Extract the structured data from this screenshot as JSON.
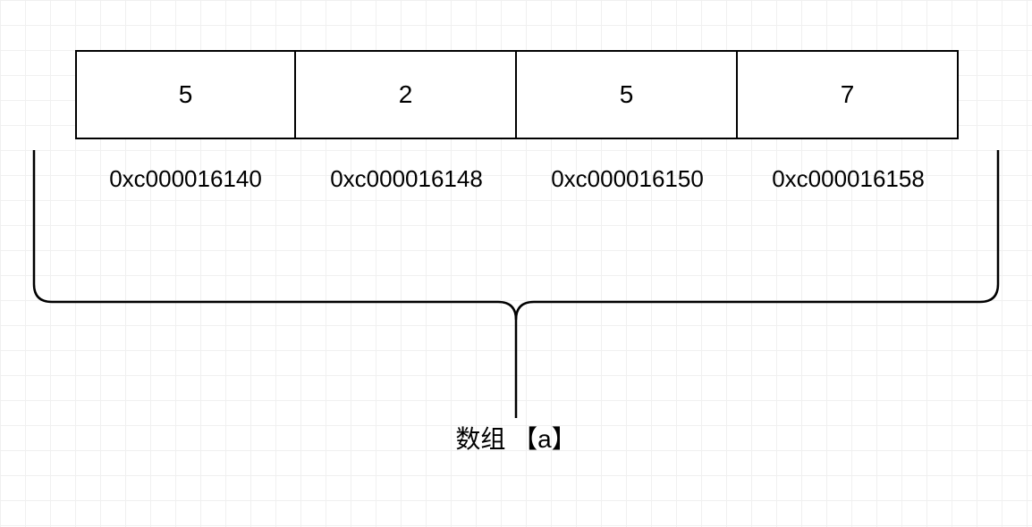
{
  "array": {
    "values": [
      "5",
      "2",
      "5",
      "7"
    ],
    "addresses": [
      "0xc000016140",
      "0xc000016148",
      "0xc000016150",
      "0xc000016158"
    ]
  },
  "label": "数组 【a】"
}
